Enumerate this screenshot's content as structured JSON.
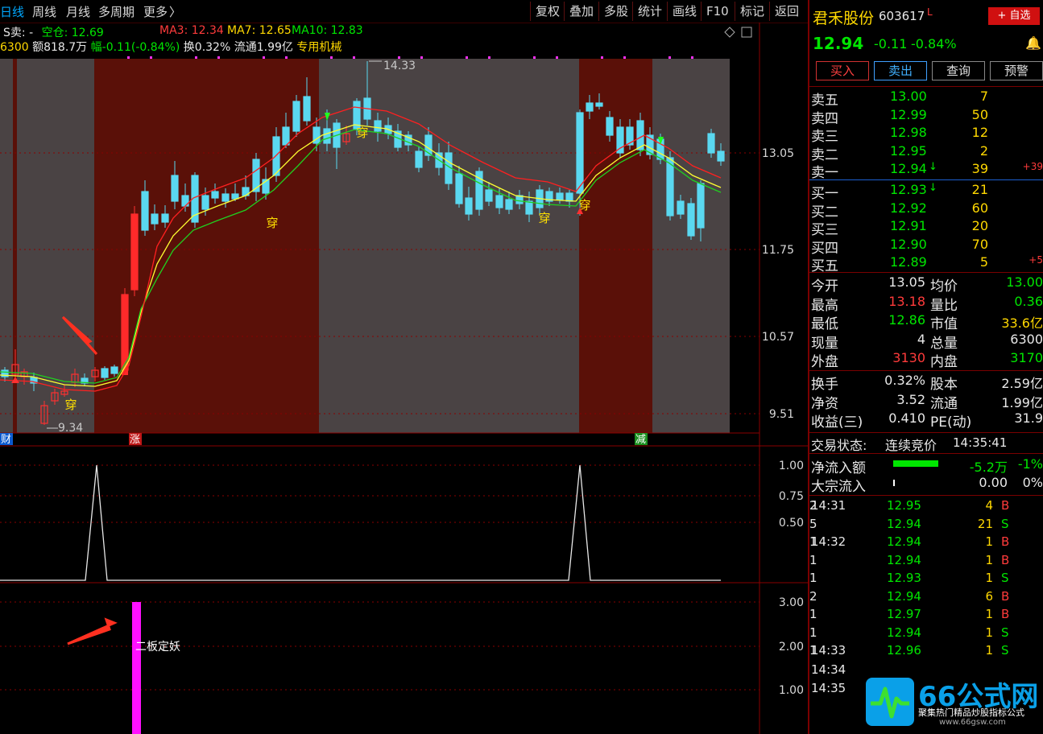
{
  "toolbar": {
    "tabs": [
      "日线",
      "周线",
      "月线",
      "多周期",
      "更多"
    ],
    "more_chevron": "〉",
    "buttons": [
      "复权",
      "叠加",
      "多股",
      "统计",
      "画线",
      "F10",
      "标记",
      "返回"
    ]
  },
  "info_line1": {
    "signal": "S卖:",
    "signal_val": "-",
    "position": "空仓: 12.69",
    "ma3": "MA3: 12.34",
    "ma7": "MA7: 12.65",
    "ma10": "MA10: 12.83"
  },
  "info_line2": {
    "vol": "6300",
    "amount": "额818.7万",
    "range": "幅-0.11(-0.84%)",
    "turnover": "换0.32%",
    "float": "流通1.99亿",
    "industry": "专用机械"
  },
  "price_axis": [
    "13.05",
    "11.75",
    "10.57",
    "9.51"
  ],
  "high_label": "14.33",
  "low_label": "9.34",
  "chuan_labels": [
    "穿",
    "穿",
    "穿",
    "穿",
    "穿"
  ],
  "bottom_markers": {
    "cai": "财",
    "zhang": "涨",
    "jian": "减"
  },
  "indicator1_axis": [
    "1.00",
    "0.75",
    "0.50"
  ],
  "indicator2_axis": [
    "3.00",
    "2.00",
    "1.00"
  ],
  "indicator2_label": "二板定妖",
  "chart_data": {
    "type": "candlestick",
    "series_lines": [
      {
        "name": "MA3",
        "color": "#ff2020"
      },
      {
        "name": "MA7",
        "color": "#ffff30"
      },
      {
        "name": "MA10",
        "color": "#20d020"
      }
    ],
    "ylim": [
      9.3,
      14.4
    ],
    "indicator1": {
      "type": "line",
      "peaks_at_bar_fraction": [
        0.13,
        0.79
      ],
      "values_range": [
        0,
        1
      ]
    },
    "indicator2": {
      "type": "bar",
      "value": 3.0,
      "label": "二板定妖"
    }
  },
  "stock": {
    "name": "君禾股份",
    "code": "603617",
    "flag": "L",
    "price": "12.94",
    "change": "-0.11",
    "pct": "-0.84%",
    "add_fav": "+ 自选",
    "bell": "bell-icon"
  },
  "actions": [
    "买入",
    "卖出",
    "查询",
    "预警"
  ],
  "sell_orders": [
    {
      "label": "卖五",
      "price": "13.00",
      "vol": "7",
      "delta": ""
    },
    {
      "label": "卖四",
      "price": "12.99",
      "vol": "50",
      "delta": ""
    },
    {
      "label": "卖三",
      "price": "12.98",
      "vol": "12",
      "delta": ""
    },
    {
      "label": "卖二",
      "price": "12.95",
      "vol": "2",
      "delta": ""
    },
    {
      "label": "卖一",
      "price": "12.94",
      "vol": "39",
      "delta": "+39"
    }
  ],
  "buy_orders": [
    {
      "label": "买一",
      "price": "12.93",
      "vol": "21",
      "delta": ""
    },
    {
      "label": "买二",
      "price": "12.92",
      "vol": "60",
      "delta": ""
    },
    {
      "label": "买三",
      "price": "12.91",
      "vol": "20",
      "delta": ""
    },
    {
      "label": "买四",
      "price": "12.90",
      "vol": "70",
      "delta": ""
    },
    {
      "label": "买五",
      "price": "12.89",
      "vol": "5",
      "delta": "+5"
    }
  ],
  "stats": [
    {
      "l1": "今开",
      "v1": "13.05",
      "l2": "均价",
      "v2": "13.00"
    },
    {
      "l1": "最高",
      "v1": "13.18",
      "l2": "量比",
      "v2": "0.36"
    },
    {
      "l1": "最低",
      "v1": "12.86",
      "l2": "市值",
      "v2": "33.6亿"
    },
    {
      "l1": "现量",
      "v1": "4",
      "l2": "总量",
      "v2": "6300"
    },
    {
      "l1": "外盘",
      "v1": "3130",
      "l2": "内盘",
      "v2": "3170"
    }
  ],
  "stats2": [
    {
      "l1": "换手",
      "v1": "0.32%",
      "l2": "股本",
      "v2": "2.59亿"
    },
    {
      "l1": "净资",
      "v1": "3.52",
      "l2": "流通",
      "v2": "1.99亿"
    },
    {
      "l1": "收益(三)",
      "v1": "0.410",
      "l2": "PE(动)",
      "v2": "31.9"
    }
  ],
  "trade_status": {
    "label": "交易状态:",
    "value": "连续竞价",
    "time": "14:35:41"
  },
  "flows": [
    {
      "label": "净流入额",
      "value": "-5.2万",
      "pct": "-1%"
    },
    {
      "label": "大宗流入",
      "value": "0.00",
      "pct": "0%"
    }
  ],
  "ticks": [
    {
      "time": "14:31",
      "price": "12.95",
      "vol": "4",
      "side": "B",
      "n": "2"
    },
    {
      "time": "",
      "price": "12.94",
      "vol": "21",
      "side": "S",
      "n": "5"
    },
    {
      "time": "14:32",
      "price": "12.94",
      "vol": "1",
      "side": "B",
      "n": "1"
    },
    {
      "time": "",
      "price": "12.94",
      "vol": "1",
      "side": "B",
      "n": "1"
    },
    {
      "time": "",
      "price": "12.93",
      "vol": "1",
      "side": "S",
      "n": "1"
    },
    {
      "time": "",
      "price": "12.94",
      "vol": "6",
      "side": "B",
      "n": "2"
    },
    {
      "time": "",
      "price": "12.97",
      "vol": "1",
      "side": "B",
      "n": "1"
    },
    {
      "time": "",
      "price": "12.94",
      "vol": "1",
      "side": "S",
      "n": "1"
    },
    {
      "time": "14:33",
      "price": "12.96",
      "vol": "1",
      "side": "S",
      "n": "1"
    },
    {
      "time": "14:34",
      "price": "",
      "vol": "",
      "side": "",
      "n": ""
    },
    {
      "time": "14:35",
      "price": "",
      "vol": "",
      "side": "",
      "n": ""
    }
  ],
  "watermark": {
    "title": "66公式网",
    "subtitle": "聚集热门精品炒股指标公式",
    "url": "www.66gsw.com"
  }
}
